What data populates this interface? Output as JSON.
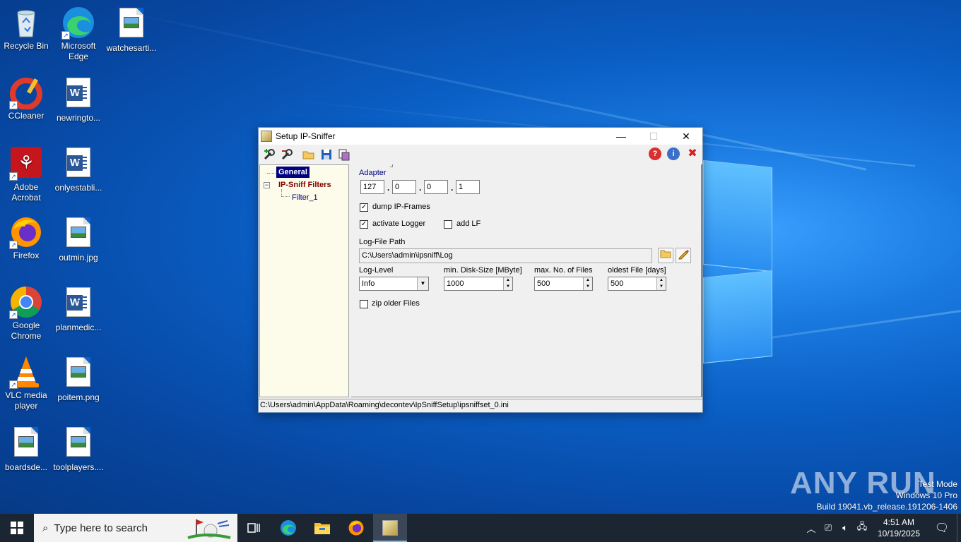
{
  "desktop": {
    "icons": [
      {
        "label": "Recycle Bin"
      },
      {
        "label": "Microsoft Edge"
      },
      {
        "label": "watchesarti..."
      },
      {
        "label": "CCleaner"
      },
      {
        "label": "newringto..."
      },
      {
        "label": "Adobe Acrobat"
      },
      {
        "label": "onlyestabli..."
      },
      {
        "label": "Firefox"
      },
      {
        "label": "outmin.jpg"
      },
      {
        "label": "Google Chrome"
      },
      {
        "label": "planmedic..."
      },
      {
        "label": "VLC media player"
      },
      {
        "label": "poitem.png"
      },
      {
        "label": "boardsde..."
      },
      {
        "label": "toolplayers...."
      }
    ],
    "watermark": {
      "mode": "Test Mode",
      "edition": "Windows 10 Pro",
      "build": "Build 19041.vb_release.191206-1406"
    },
    "anyrun_logo": "ANY RUN"
  },
  "window": {
    "title": "Setup IP-Sniffer",
    "tree": {
      "general": "General",
      "filters": "IP-Sniff Filters",
      "filter1": "Filter_1"
    },
    "general": {
      "adapter_label": "Adapter",
      "ip": [
        "127",
        "0",
        "0",
        "1"
      ],
      "dump_frames_label": "dump IP-Frames",
      "dump_frames_checked": true,
      "activate_logger_label": "activate Logger",
      "activate_logger_checked": true,
      "add_lf_label": "add LF",
      "add_lf_checked": false,
      "log_path_label": "Log-File Path",
      "log_path_value": "C:\\Users\\admin\\ipsniff\\Log",
      "log_level_label": "Log-Level",
      "log_level_value": "Info",
      "min_disk_label": "min. Disk-Size [MByte]",
      "min_disk_value": "1000",
      "max_files_label": "max. No. of Files",
      "max_files_value": "500",
      "oldest_label": "oldest File [days]",
      "oldest_value": "500",
      "zip_label": "zip older Files",
      "zip_checked": false
    },
    "status_path": "C:\\Users\\admin\\AppData\\Roaming\\decontev\\IpSniffSetup\\ipsniffset_0.ini"
  },
  "taskbar": {
    "search_placeholder": "Type here to search",
    "time": "4:51 AM",
    "date": "10/19/2025"
  }
}
